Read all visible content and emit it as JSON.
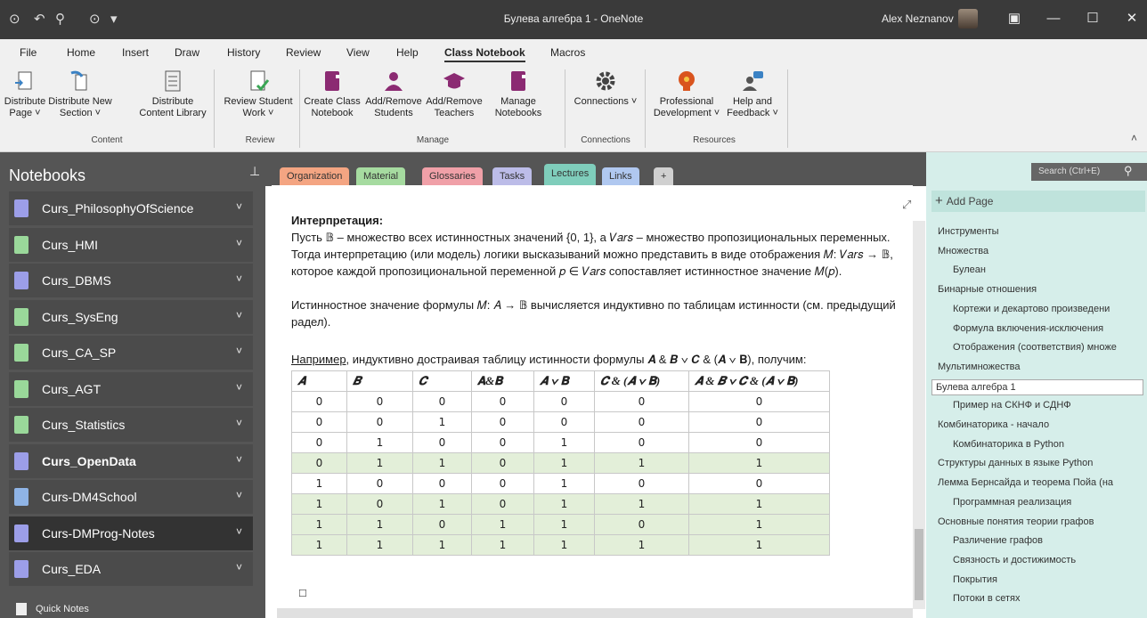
{
  "window": {
    "title": "Булева алгебра 1 - OneNote",
    "user": "Alex Neznanov"
  },
  "menu": [
    "File",
    "Home",
    "Insert",
    "Draw",
    "History",
    "Review",
    "View",
    "Help",
    "Class Notebook",
    "Macros"
  ],
  "ribbon": {
    "buttons": [
      {
        "label": "Distribute Page ˅"
      },
      {
        "label": "Distribute New Section ˅"
      },
      {
        "label": "Distribute Content Library"
      },
      {
        "label": "Review Student Work ˅"
      },
      {
        "label": "Create Class Notebook"
      },
      {
        "label": "Add/Remove Students"
      },
      {
        "label": "Add/Remove Teachers"
      },
      {
        "label": "Manage Notebooks"
      },
      {
        "label": "Connections ˅"
      },
      {
        "label": "Professional Development ˅"
      },
      {
        "label": "Help and Feedback ˅"
      }
    ],
    "groups": [
      "Content",
      "Review",
      "Manage",
      "Connections",
      "Resources"
    ]
  },
  "notebooks_header": "Notebooks",
  "notebooks": [
    {
      "name": "Curs_PhilosophyOfScience",
      "color": "#9c9ee8"
    },
    {
      "name": "Curs_HMI",
      "color": "#9ad89a"
    },
    {
      "name": "Curs_DBMS",
      "color": "#9c9ee8"
    },
    {
      "name": "Curs_SysEng",
      "color": "#9ad89a"
    },
    {
      "name": "Curs_CA_SP",
      "color": "#9ad89a"
    },
    {
      "name": "Curs_AGT",
      "color": "#9ad89a"
    },
    {
      "name": "Curs_Statistics",
      "color": "#9ad89a"
    },
    {
      "name": "Curs_OpenData",
      "color": "#9c9ee8"
    },
    {
      "name": "Curs-DM4School",
      "color": "#8fb4e6"
    },
    {
      "name": "Curs-DMProg-Notes",
      "color": "#9c9ee8"
    },
    {
      "name": "Curs_EDA",
      "color": "#9c9ee8"
    }
  ],
  "quick_notes": "Quick Notes",
  "sections": [
    {
      "name": "Organization",
      "color": "#f4a582"
    },
    {
      "name": "Material",
      "color": "#a6dba0"
    },
    {
      "name": "Glossaries",
      "color": "#f0a0a8"
    },
    {
      "name": "Tasks",
      "color": "#bcbce8"
    },
    {
      "name": "Lectures",
      "color": "#7fcdbb"
    },
    {
      "name": "Links",
      "color": "#b0c8f0"
    },
    {
      "name": "+",
      "color": "#d0d0d0"
    }
  ],
  "content": {
    "heading": "Интерпретация:",
    "para1": "Пусть 𝔹 – множество всех истинностных значений {0, 1}, а 𝑉𝑎𝑟𝑠 – множество пропозициональных переменных. Тогда интерпретацию (или модель) логики высказываний можно представить в виде отображения 𝑀: 𝑉𝑎𝑟𝑠 → 𝔹, которое каждой пропозициональной переменной 𝑝 ∈ 𝑉𝑎𝑟𝑠 сопоставляет истинностное значение 𝑀(𝑝).",
    "para2": "Истинностное значение формулы 𝑀: 𝐴 → 𝔹 вычисляется индуктивно по таблицам истинности (см. предыдущий радел).",
    "example_label": "Например",
    "example_text": ", индуктивно достраивая таблицу истинности формулы 𝑨 & 𝑩 ∨ 𝑪 & (𝑨 ∨ 𝐁), получим:",
    "table_headers": [
      "𝑨",
      "𝑩",
      "𝑪",
      "𝐀&𝐁",
      "𝑨 ∨ 𝐁",
      "𝑪 & (𝑨 ∨ 𝐁)",
      "𝑨 & 𝑩 ∨ 𝑪 & (𝑨 ∨ 𝐁)"
    ],
    "table_rows": [
      {
        "cells": [
          "0",
          "0",
          "0",
          "0",
          "0",
          "0",
          "0"
        ],
        "hl": false
      },
      {
        "cells": [
          "0",
          "0",
          "1",
          "0",
          "0",
          "0",
          "0"
        ],
        "hl": false
      },
      {
        "cells": [
          "0",
          "1",
          "0",
          "0",
          "1",
          "0",
          "0"
        ],
        "hl": false
      },
      {
        "cells": [
          "0",
          "1",
          "1",
          "0",
          "1",
          "1",
          "1"
        ],
        "hl": true
      },
      {
        "cells": [
          "1",
          "0",
          "0",
          "0",
          "1",
          "0",
          "0"
        ],
        "hl": false
      },
      {
        "cells": [
          "1",
          "0",
          "1",
          "0",
          "1",
          "1",
          "1"
        ],
        "hl": true
      },
      {
        "cells": [
          "1",
          "1",
          "0",
          "1",
          "1",
          "0",
          "1"
        ],
        "hl": true
      },
      {
        "cells": [
          "1",
          "1",
          "1",
          "1",
          "1",
          "1",
          "1"
        ],
        "hl": true
      }
    ]
  },
  "search_placeholder": "Search (Ctrl+E)",
  "add_page": "Add Page",
  "pages": [
    {
      "title": "Инструменты",
      "sub": false
    },
    {
      "title": "Множества",
      "sub": false
    },
    {
      "title": "Булеан",
      "sub": true
    },
    {
      "title": "Бинарные отношения",
      "sub": false
    },
    {
      "title": "Кортежи и декартово произведени",
      "sub": true
    },
    {
      "title": "Формула включения-исключения",
      "sub": true
    },
    {
      "title": "Отображения (соответствия) множе",
      "sub": true
    },
    {
      "title": "Мультимножества",
      "sub": false
    },
    {
      "title": "Булева алгебра 1",
      "sub": false,
      "selected": true
    },
    {
      "title": "Пример на СКНФ и СДНФ",
      "sub": true
    },
    {
      "title": "Комбинаторика - начало",
      "sub": false
    },
    {
      "title": "Комбинаторика в Python",
      "sub": true
    },
    {
      "title": "Структуры данных в языке Python",
      "sub": false
    },
    {
      "title": "Лемма Бернсайда и теорема Пойа (на",
      "sub": false
    },
    {
      "title": "Программная реализация",
      "sub": true
    },
    {
      "title": "Основные понятия теории графов",
      "sub": false
    },
    {
      "title": "Различение графов",
      "sub": true
    },
    {
      "title": "Связность и достижимость",
      "sub": true
    },
    {
      "title": "Покрытия",
      "sub": true
    },
    {
      "title": "Потоки в сетях",
      "sub": true
    }
  ]
}
